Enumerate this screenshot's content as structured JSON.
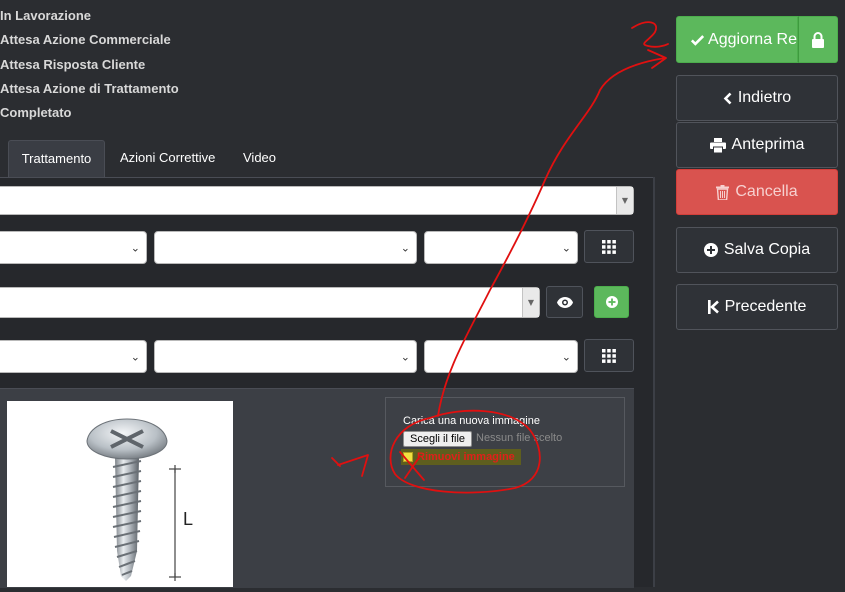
{
  "status_list": [
    {
      "label": "In Lavorazione"
    },
    {
      "label": "Attesa Azione Commerciale"
    },
    {
      "label": "Attesa Risposta Cliente"
    },
    {
      "label": "Attesa Azione di Trattamento"
    },
    {
      "label": "Completato"
    }
  ],
  "tabs": [
    {
      "label": "Trattamento",
      "active": true
    },
    {
      "label": "Azioni Correttive",
      "active": false
    },
    {
      "label": "Video",
      "active": false
    }
  ],
  "upload": {
    "label": "Carica una nuova immagine",
    "choose_button": "Scegli il file",
    "no_file_text": "Nessun file scelto",
    "remove_label": "Rimuovi immagine"
  },
  "image": {
    "dimension_label": "L"
  },
  "actions": {
    "update": "Aggiorna Re",
    "back": "Indietro",
    "preview": "Anteprima",
    "delete": "Cancella",
    "save_copy": "Salva Copia",
    "previous": "Precedente"
  },
  "annotations": {
    "step1": "1",
    "step2": "2"
  },
  "colors": {
    "background": "#2b2d31",
    "success": "#5cb85c",
    "danger": "#d9534f",
    "annotation": "#e01010"
  },
  "icons": {
    "update": "check-icon",
    "lock": "lock-icon",
    "back": "chevron-left-icon",
    "preview": "print-icon",
    "delete": "trash-icon",
    "save_copy": "plus-circle-icon",
    "previous": "step-backward-icon",
    "grid": "grid-icon",
    "eye": "eye-icon",
    "add": "plus-circle-icon"
  }
}
